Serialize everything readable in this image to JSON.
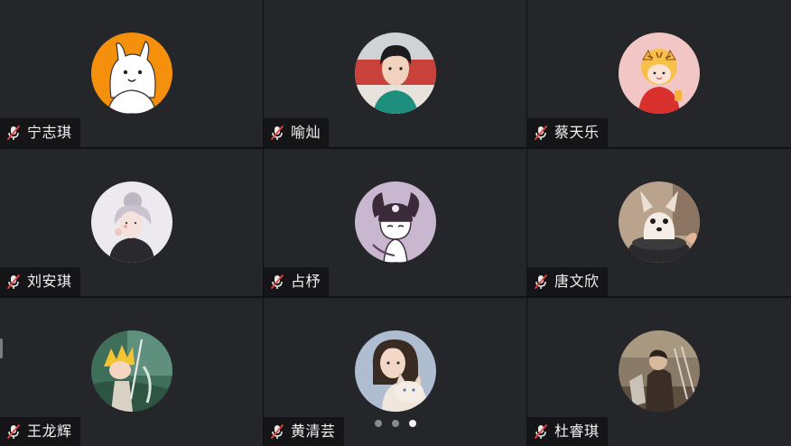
{
  "participants": [
    {
      "name": "宁志琪",
      "avatar": "cartoon-rabbit-avatar",
      "mic": "muted"
    },
    {
      "name": "喻灿",
      "avatar": "young-man-photo-avatar",
      "mic": "muted"
    },
    {
      "name": "蔡天乐",
      "avatar": "tiger-costume-girl-avatar",
      "mic": "muted"
    },
    {
      "name": "刘安琪",
      "avatar": "illustrated-girl-avatar",
      "mic": "muted"
    },
    {
      "name": "占杼",
      "avatar": "kuromi-avatar",
      "mic": "muted"
    },
    {
      "name": "唐文欣",
      "avatar": "puppy-photo-avatar",
      "mic": "muted"
    },
    {
      "name": "王龙辉",
      "avatar": "anime-character-avatar",
      "mic": "muted"
    },
    {
      "name": "黄清芸",
      "avatar": "girl-with-cat-avatar",
      "mic": "muted"
    },
    {
      "name": "杜睿琪",
      "avatar": "people-photo-avatar",
      "mic": "muted"
    }
  ],
  "pagination": {
    "total_pages": 3,
    "current_page": 3
  },
  "colors": {
    "tile_bg": "#252629",
    "divider": "#111214",
    "muted_icon": "#e8e8e8",
    "muted_slash": "#e0443e",
    "page_dot": "#8a8b8f",
    "page_dot_active": "#f4f4f4"
  }
}
